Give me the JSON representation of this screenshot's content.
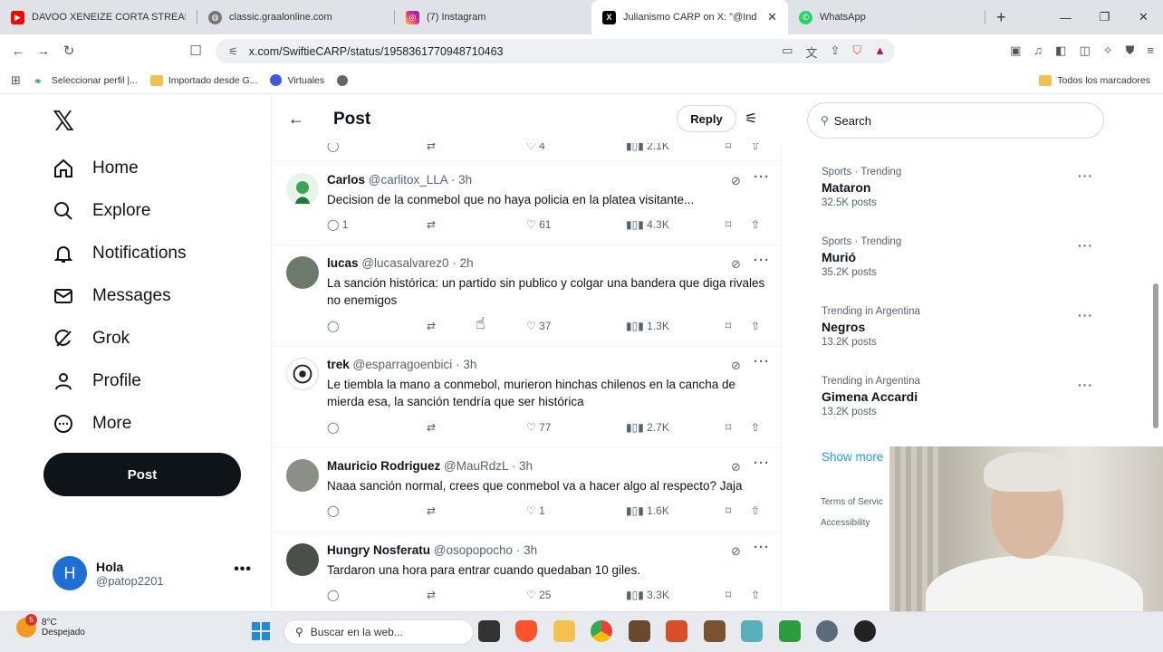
{
  "browser": {
    "tabs": [
      {
        "title": "DAVOO XENEIZE CORTA STREAM",
        "icon": "youtube-icon",
        "color": "#ff0000"
      },
      {
        "title": "classic.graalonline.com",
        "icon": "globe-icon",
        "color": "#555555"
      },
      {
        "title": "(7) Instagram",
        "icon": "instagram-icon",
        "color": "#d62976"
      },
      {
        "title": "Julianismo CARP on X: \"@Ind",
        "icon": "x-icon",
        "color": "#000000",
        "active": true
      },
      {
        "title": "WhatsApp",
        "icon": "whatsapp-icon",
        "color": "#25d366"
      }
    ],
    "url": "x.com/SwiftieCARP/status/1958361770948710463",
    "bookmarks": [
      {
        "label": "Seleccionar perfil |...",
        "icon": "profile-icon"
      },
      {
        "label": "Importado desde G...",
        "icon": "folder-icon"
      },
      {
        "label": "Virtuales",
        "icon": "virtuales-icon"
      },
      {
        "label": "",
        "icon": "globe-icon"
      }
    ],
    "all_bookmarks": "Todos los marcadores"
  },
  "nav": {
    "items": [
      {
        "label": "Home",
        "icon": "home-icon"
      },
      {
        "label": "Explore",
        "icon": "search-icon"
      },
      {
        "label": "Notifications",
        "icon": "bell-icon"
      },
      {
        "label": "Messages",
        "icon": "mail-icon"
      },
      {
        "label": "Grok",
        "icon": "grok-icon"
      },
      {
        "label": "Profile",
        "icon": "person-icon"
      },
      {
        "label": "More",
        "icon": "more-circle-icon"
      }
    ],
    "post_label": "Post",
    "user": {
      "initial": "H",
      "name": "Hola",
      "handle": "@patop2201"
    }
  },
  "header": {
    "title": "Post",
    "reply_label": "Reply"
  },
  "top_partial": {
    "likes": "4",
    "views": "2.1K"
  },
  "tweets": [
    {
      "name": "Carlos",
      "handle": "@carlitox_LLA",
      "time": "3h",
      "text": "Decision de la conmebol que no haya policia en la platea visitante...",
      "replies": "1",
      "likes": "61",
      "views": "4.3K",
      "avatar": "#3aa655"
    },
    {
      "name": "lucas",
      "handle": "@lucasalvarez0",
      "time": "2h",
      "text": "La sanción histórica: un partido sin publico y colgar una bandera que diga rivales no enemigos",
      "replies": "",
      "likes": "37",
      "views": "1.3K",
      "avatar": "#6c7a6e"
    },
    {
      "name": "trek",
      "handle": "@esparragoenbici",
      "time": "3h",
      "text": "Le tiembla la mano a conmebol, murieron hinchas chilenos en la cancha de mierda esa, la sanción tendría que ser histórica",
      "replies": "",
      "likes": "77",
      "views": "2.7K",
      "avatar": "#222222"
    },
    {
      "name": "Mauricio Rodriguez",
      "handle": "@MauRdzL",
      "time": "3h",
      "text": "Naaa sanción normal, crees que conmebol va a hacer algo al respecto? Jaja",
      "replies": "",
      "likes": "1",
      "views": "1.6K",
      "avatar": "#8a8f88"
    },
    {
      "name": "Hungry Nosferatu",
      "handle": "@osopopocho",
      "time": "3h",
      "text": "Tardaron una hora para entrar cuando quedaban 10 giles.",
      "replies": "",
      "likes": "25",
      "views": "3.3K",
      "avatar": "#4b4f4a"
    }
  ],
  "right": {
    "search_placeholder": "Search",
    "trends": [
      {
        "category": "Sports · Trending",
        "name": "Mataron",
        "count": "32.5K posts"
      },
      {
        "category": "Sports · Trending",
        "name": "Murió",
        "count": "35.2K posts"
      },
      {
        "category": "Trending in Argentina",
        "name": "Negros",
        "count": "13.2K posts"
      },
      {
        "category": "Trending in Argentina",
        "name": "Gimena Accardi",
        "count": "13.2K posts"
      }
    ],
    "show_more": "Show more",
    "footer": [
      "Terms of Servic",
      "Accessibility"
    ]
  },
  "taskbar": {
    "temp": "8°C",
    "weather": "Despejado",
    "badge": "5",
    "search_placeholder": "Buscar en la web..."
  }
}
